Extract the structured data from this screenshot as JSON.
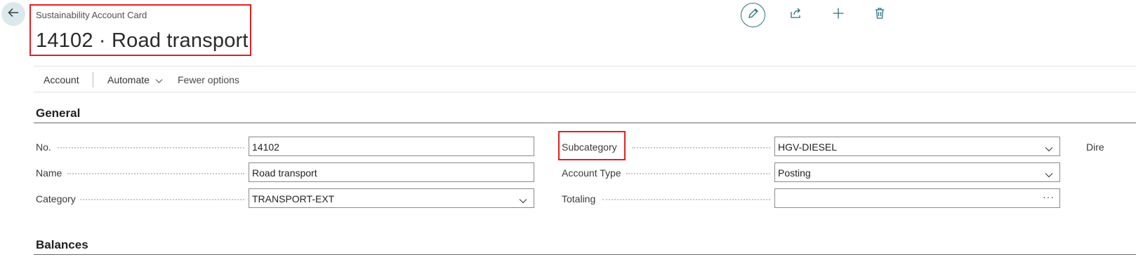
{
  "header": {
    "caption": "Sustainability Account Card",
    "title": "14102 · Road transport"
  },
  "icons": {
    "back": "back-arrow-icon",
    "edit": "pencil-icon",
    "share": "share-icon",
    "new": "plus-icon",
    "delete": "trash-icon"
  },
  "actions": {
    "account": "Account",
    "automate": "Automate",
    "fewer_options": "Fewer options"
  },
  "sections": {
    "general": "General",
    "balances": "Balances"
  },
  "fields": {
    "no": {
      "label": "No.",
      "value": "14102"
    },
    "name": {
      "label": "Name",
      "value": "Road transport"
    },
    "category": {
      "label": "Category",
      "value": "TRANSPORT-EXT"
    },
    "subcategory": {
      "label": "Subcategory",
      "value": "HGV-DIESEL"
    },
    "account_type": {
      "label": "Account Type",
      "value": "Posting"
    },
    "totaling": {
      "label": "Totaling",
      "value": ""
    },
    "truncated_label": "Dire"
  },
  "colors": {
    "accent": "#2b6f82",
    "highlight": "#e02020",
    "back_bg": "#dbe9ec"
  }
}
